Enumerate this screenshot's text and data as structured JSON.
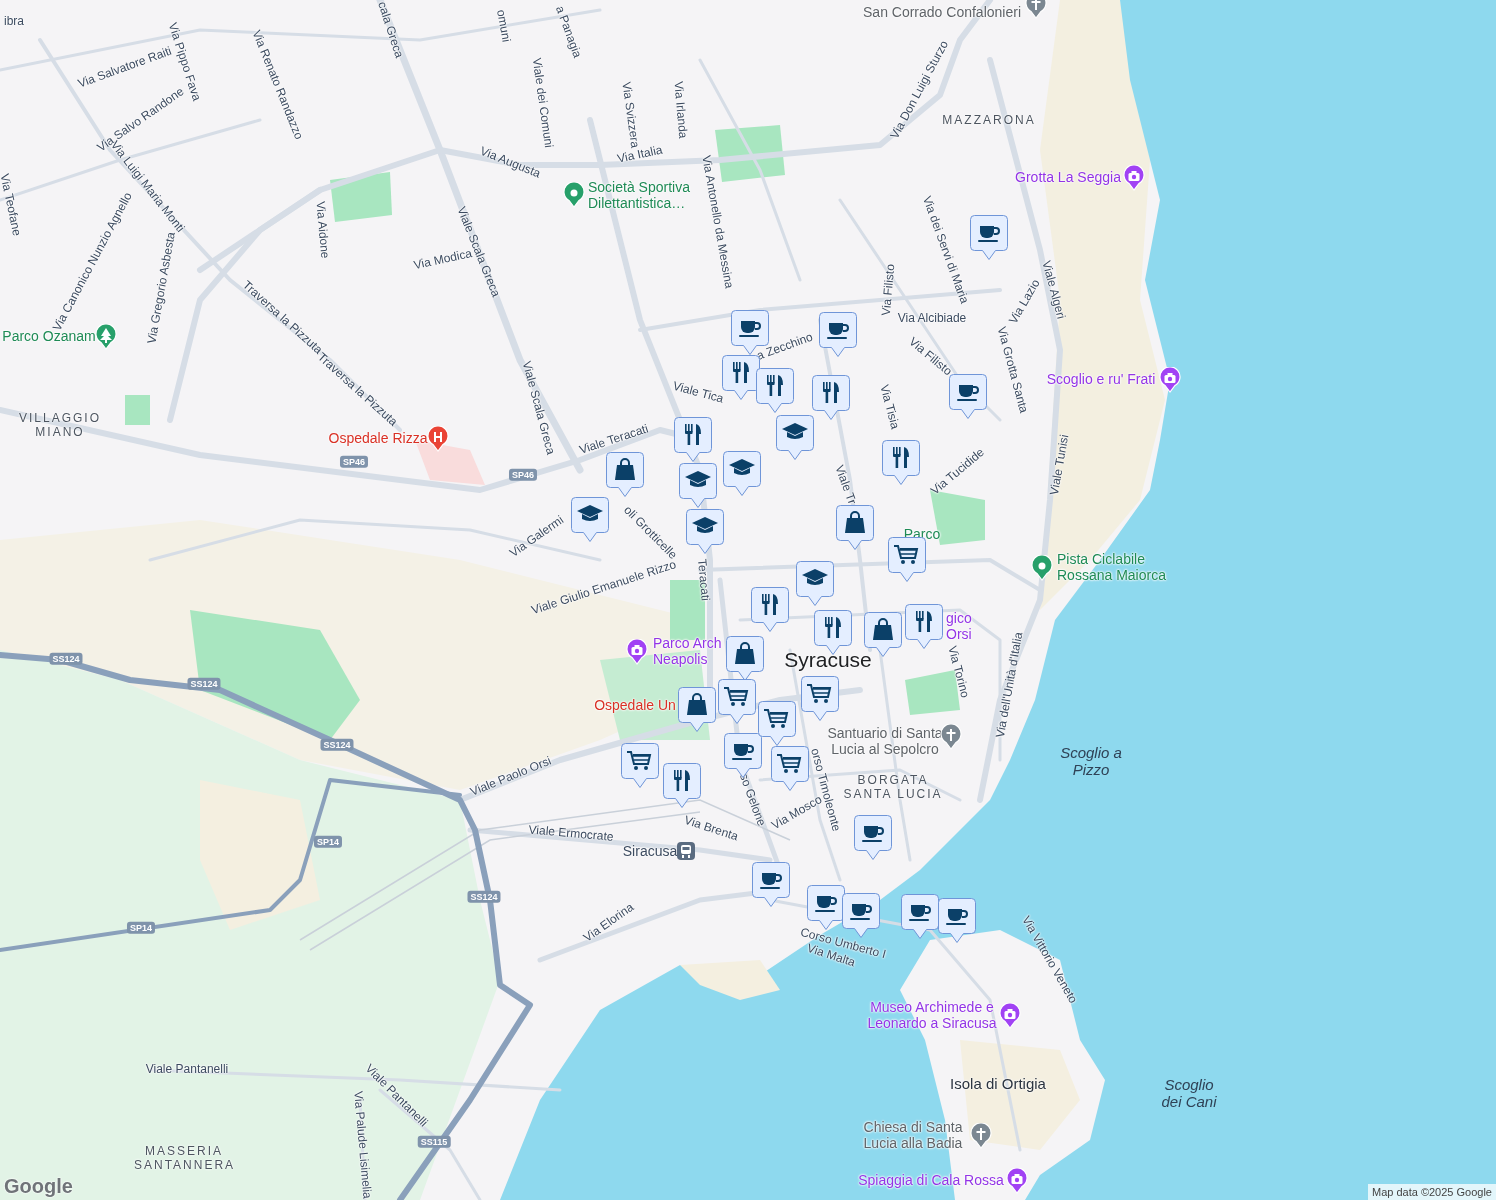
{
  "map": {
    "labels": [
      {
        "text": "ibra",
        "kind": "street"
      },
      {
        "text": "Via Salvatore Raiti",
        "kind": "street"
      },
      {
        "text": "Via Pippo Fava",
        "kind": "street"
      },
      {
        "text": "Via Salvo Randone",
        "kind": "street"
      },
      {
        "text": "Via Renato Randazzo",
        "kind": "street"
      },
      {
        "text": "Via Luigi Maria Monti",
        "kind": "street"
      },
      {
        "text": "Via Teofane",
        "kind": "street"
      },
      {
        "text": "Via Canonico Nunzio Agnello",
        "kind": "street"
      },
      {
        "text": "Via Gregorio Asbesta",
        "kind": "street"
      },
      {
        "text": "Via Aidone",
        "kind": "street"
      },
      {
        "text": "Via Modica",
        "kind": "street"
      },
      {
        "text": "Viale Scala Greca",
        "kind": "street"
      },
      {
        "text": "cala Greca",
        "kind": "street"
      },
      {
        "text": "Via Augusta",
        "kind": "street"
      },
      {
        "text": "Viale dei Comuni",
        "kind": "street"
      },
      {
        "text": "omuni",
        "kind": "street"
      },
      {
        "text": "a Panagia",
        "kind": "street"
      },
      {
        "text": "Via Svizzera",
        "kind": "street"
      },
      {
        "text": "Via Irlanda",
        "kind": "street"
      },
      {
        "text": "Via Italia",
        "kind": "street"
      },
      {
        "text": "Via Antonello da Messina",
        "kind": "street"
      },
      {
        "text": "Via Don Luigi Sturzo",
        "kind": "street"
      },
      {
        "text": "Traversa la Pizzuta",
        "kind": "street"
      },
      {
        "text": "Traversa la Pizzuta",
        "kind": "street"
      },
      {
        "text": "Viale Scala Greca",
        "kind": "street"
      },
      {
        "text": "Viale Teracati",
        "kind": "street"
      },
      {
        "text": "Viale Tica",
        "kind": "street"
      },
      {
        "text": "a Zecchino",
        "kind": "street"
      },
      {
        "text": "Via Filisto",
        "kind": "street"
      },
      {
        "text": "Via Alcibiade",
        "kind": "street"
      },
      {
        "text": "Via dei Servi di Maria",
        "kind": "street"
      },
      {
        "text": "Via Filisto",
        "kind": "street"
      },
      {
        "text": "Via Tisia",
        "kind": "street"
      },
      {
        "text": "Via Lazio",
        "kind": "street"
      },
      {
        "text": "Via Grotta Santa",
        "kind": "street"
      },
      {
        "text": "Viale Algeri",
        "kind": "street"
      },
      {
        "text": "Via Tucidide",
        "kind": "street"
      },
      {
        "text": "Viale Tunisi",
        "kind": "street"
      },
      {
        "text": "Via Galermi",
        "kind": "street"
      },
      {
        "text": "Viale Giulio Emanuele Rizzo",
        "kind": "street"
      },
      {
        "text": "oli Grotticelle",
        "kind": "street"
      },
      {
        "text": "Teracati",
        "kind": "street"
      },
      {
        "text": "Viale Tr",
        "kind": "street"
      },
      {
        "text": "Via Torino",
        "kind": "street"
      },
      {
        "text": "Via dell'Unità d'Italia",
        "kind": "street"
      },
      {
        "text": "Viale Paolo Orsi",
        "kind": "street"
      },
      {
        "text": "Viale Ermocrate",
        "kind": "street"
      },
      {
        "text": "Via Brenta",
        "kind": "street"
      },
      {
        "text": "so Gelone",
        "kind": "street"
      },
      {
        "text": "Via Mosco",
        "kind": "street"
      },
      {
        "text": "orso Timoleonte",
        "kind": "street"
      },
      {
        "text": "Via Elorina",
        "kind": "street"
      },
      {
        "text": "Corso Umberto I",
        "kind": "street"
      },
      {
        "text": "Via Malta",
        "kind": "street"
      },
      {
        "text": "Via Vittorio Veneto",
        "kind": "street"
      },
      {
        "text": "Viale Pantanelli",
        "kind": "street"
      },
      {
        "text": "Viale Pantanelli",
        "kind": "street"
      },
      {
        "text": "Via Palude Lisimelia",
        "kind": "street"
      },
      {
        "text": "MAZZARONA",
        "kind": "district"
      },
      {
        "text": "VILLAGGIO MIANO",
        "kind": "district"
      },
      {
        "text": "BORGATA SANTA LUCIA",
        "kind": "district"
      },
      {
        "text": "MASSERIA SANTANNERA",
        "kind": "district"
      },
      {
        "text": "Syracuse",
        "kind": "city"
      },
      {
        "text": "Isola di Ortigia",
        "kind": "place"
      },
      {
        "text": "Scoglio a Pizzo",
        "kind": "water"
      },
      {
        "text": "Scoglio dei Cani",
        "kind": "water"
      },
      {
        "text": "SP46",
        "kind": "shield"
      },
      {
        "text": "SP46",
        "kind": "shield"
      },
      {
        "text": "SS124",
        "kind": "shield"
      },
      {
        "text": "SS124",
        "kind": "shield"
      },
      {
        "text": "SS124",
        "kind": "shield"
      },
      {
        "text": "SP14",
        "kind": "shield"
      },
      {
        "text": "SP14",
        "kind": "shield"
      },
      {
        "text": "SS124",
        "kind": "shield"
      },
      {
        "text": "SS115",
        "kind": "shield"
      }
    ],
    "pois": [
      {
        "text": "San Corrado Confalonieri",
        "kind": "worship"
      },
      {
        "text": "Grotta La Seggia",
        "kind": "attraction"
      },
      {
        "text": "Società Sportiva Dilettantistica…",
        "kind": "sport"
      },
      {
        "text": "Parco Ozanam",
        "kind": "park"
      },
      {
        "text": "Scoglio e ru' Frati",
        "kind": "attraction"
      },
      {
        "text": "Ospedale Rizza",
        "kind": "hospital"
      },
      {
        "text": "Parco",
        "kind": "park_text"
      },
      {
        "text": "Pista Ciclabile Rossana Maiorca",
        "kind": "sport"
      },
      {
        "text": "Parco Arch Neapolis",
        "kind": "attraction"
      },
      {
        "text": "gico Orsi",
        "kind": "attraction_text"
      },
      {
        "text": "Ospedale Un",
        "kind": "hospital_text"
      },
      {
        "text": "Santuario di Santa Lucia al Sepolcro",
        "kind": "worship"
      },
      {
        "text": "Siracusa",
        "kind": "station"
      },
      {
        "text": "Museo Archimede e Leonardo a Siracusa",
        "kind": "attraction"
      },
      {
        "text": "Chiesa di Santa Lucia alla Badia",
        "kind": "worship"
      },
      {
        "text": "Spiaggia di Cala Rossa",
        "kind": "attraction"
      }
    ],
    "markers": [
      {
        "kind": "cafe"
      },
      {
        "kind": "cafe"
      },
      {
        "kind": "cafe"
      },
      {
        "kind": "cafe"
      },
      {
        "kind": "cafe"
      },
      {
        "kind": "cafe"
      },
      {
        "kind": "cafe"
      },
      {
        "kind": "cafe"
      },
      {
        "kind": "cafe"
      },
      {
        "kind": "cafe"
      },
      {
        "kind": "cafe"
      },
      {
        "kind": "restaurant"
      },
      {
        "kind": "restaurant"
      },
      {
        "kind": "restaurant"
      },
      {
        "kind": "restaurant"
      },
      {
        "kind": "restaurant"
      },
      {
        "kind": "restaurant"
      },
      {
        "kind": "restaurant"
      },
      {
        "kind": "restaurant"
      },
      {
        "kind": "restaurant"
      },
      {
        "kind": "school"
      },
      {
        "kind": "school"
      },
      {
        "kind": "school"
      },
      {
        "kind": "school"
      },
      {
        "kind": "school"
      },
      {
        "kind": "school"
      },
      {
        "kind": "shopping"
      },
      {
        "kind": "shopping"
      },
      {
        "kind": "shopping"
      },
      {
        "kind": "shopping"
      },
      {
        "kind": "shopping"
      },
      {
        "kind": "grocery"
      },
      {
        "kind": "grocery"
      },
      {
        "kind": "grocery"
      },
      {
        "kind": "grocery"
      },
      {
        "kind": "grocery"
      },
      {
        "kind": "grocery"
      }
    ],
    "logo": "Google",
    "attribution": "Map data ©2025 Google"
  }
}
